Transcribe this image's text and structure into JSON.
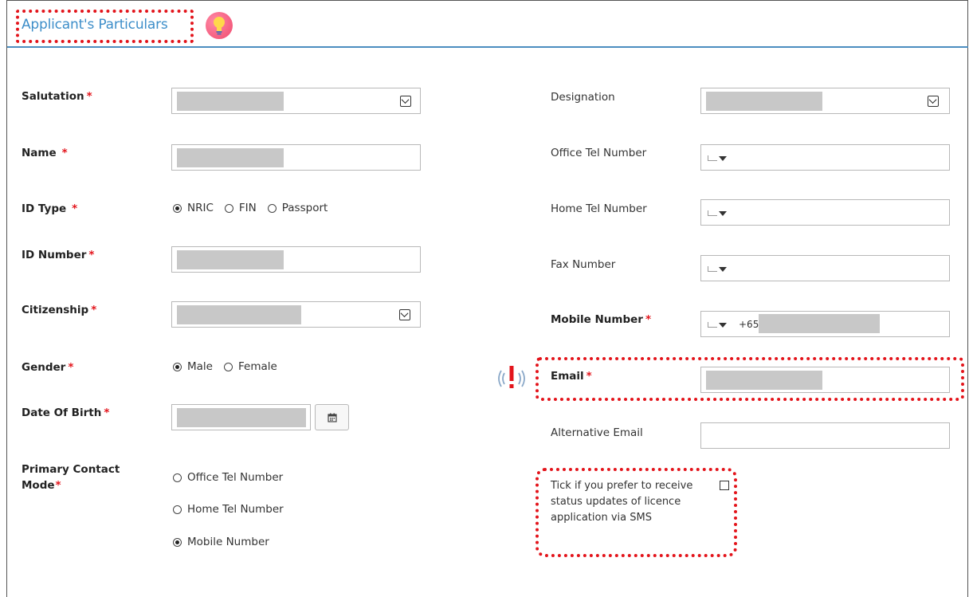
{
  "header": {
    "title": "Applicant's Particulars"
  },
  "left": {
    "salutation": {
      "label": "Salutation"
    },
    "name": {
      "label": "Name"
    },
    "id_type": {
      "label": "ID Type",
      "options": [
        "NRIC",
        "FIN",
        "Passport"
      ],
      "selected": "NRIC"
    },
    "id_number": {
      "label": "ID Number"
    },
    "citizenship": {
      "label": "Citizenship"
    },
    "gender": {
      "label": "Gender",
      "options": [
        "Male",
        "Female"
      ],
      "selected": "Male"
    },
    "dob": {
      "label": "Date Of Birth"
    },
    "primary_contact": {
      "label_line1": "Primary Contact",
      "label_line2": "Mode",
      "options": [
        "Office Tel Number",
        "Home Tel Number",
        "Mobile Number"
      ],
      "selected": "Mobile Number"
    }
  },
  "right": {
    "designation": {
      "label": "Designation"
    },
    "office_tel": {
      "label": "Office Tel Number"
    },
    "home_tel": {
      "label": "Home Tel Number"
    },
    "fax": {
      "label": "Fax Number"
    },
    "mobile": {
      "label": "Mobile Number",
      "prefix": "+65"
    },
    "email": {
      "label": "Email"
    },
    "alt_email": {
      "label": "Alternative Email"
    },
    "sms": {
      "text": "Tick if you prefer to receive status updates of licence application via SMS"
    }
  },
  "required_mark": "*",
  "colors": {
    "accent": "#3d8ec9",
    "required": "#e3141b",
    "highlight": "#e3141b"
  }
}
